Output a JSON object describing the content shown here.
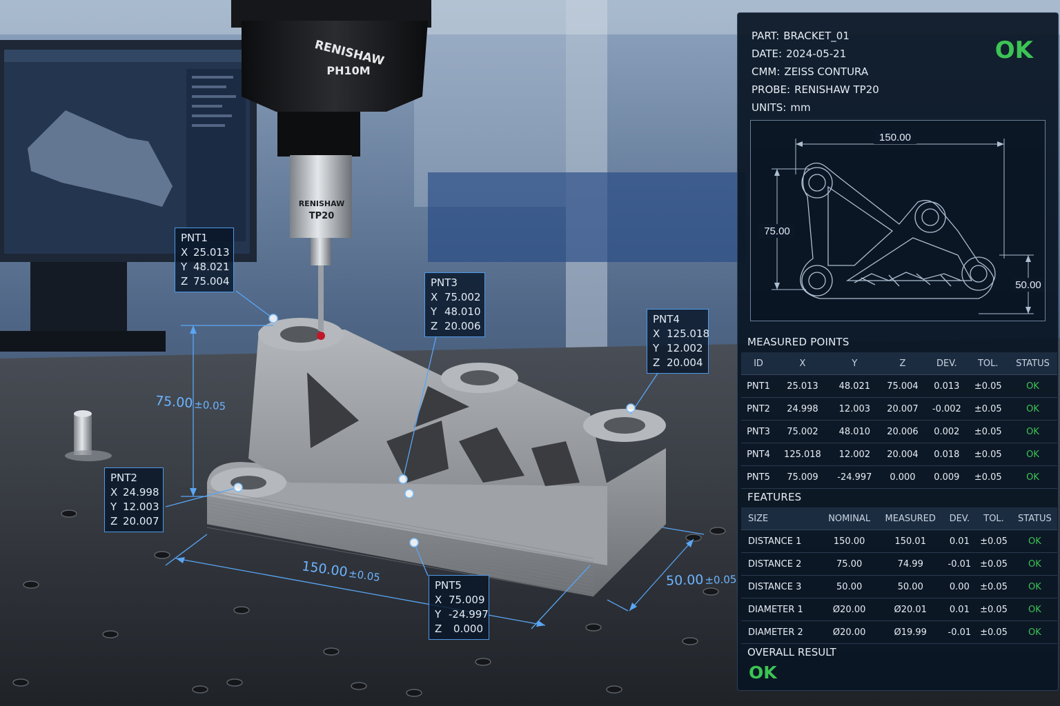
{
  "probe_head": {
    "brand": "RENISHAW",
    "model": "PH10M"
  },
  "probe_body": {
    "brand": "RENISHAW",
    "model": "TP20"
  },
  "points": [
    {
      "id": "PNT1",
      "x": "25.013",
      "y": "48.021",
      "z": "75.004"
    },
    {
      "id": "PNT2",
      "x": "24.998",
      "y": "12.003",
      "z": "20.007"
    },
    {
      "id": "PNT3",
      "x": "75.002",
      "y": "48.010",
      "z": "20.006"
    },
    {
      "id": "PNT4",
      "x": "125.018",
      "y": "12.002",
      "z": "20.004"
    },
    {
      "id": "PNT5",
      "x": "75.009",
      "y": "-24.997",
      "z": "0.000"
    }
  ],
  "axis_labels": {
    "x": "X",
    "y": "Y",
    "z": "Z"
  },
  "dims": {
    "height": {
      "value": "75.00",
      "tol": "±0.05"
    },
    "length": {
      "value": "150.00",
      "tol": "±0.05"
    },
    "width": {
      "value": "50.00",
      "tol": "±0.05"
    }
  },
  "report": {
    "meta": [
      {
        "label": "PART:",
        "value": "BRACKET_01"
      },
      {
        "label": "DATE:",
        "value": "2024-05-21"
      },
      {
        "label": "CMM:",
        "value": "ZEISS CONTURA"
      },
      {
        "label": "PROBE:",
        "value": "RENISHAW TP20"
      },
      {
        "label": "UNITS:",
        "value": "mm"
      }
    ],
    "status": "OK",
    "drawing": {
      "dim_top": "150.00",
      "dim_left": "75.00",
      "dim_right": "50.00"
    },
    "measured_points": {
      "title": "MEASURED POINTS",
      "headers": [
        "ID",
        "X",
        "Y",
        "Z",
        "DEV.",
        "TOL.",
        "STATUS"
      ],
      "rows": [
        [
          "PNT1",
          "25.013",
          "48.021",
          "75.004",
          "0.013",
          "±0.05",
          "OK"
        ],
        [
          "PNT2",
          "24.998",
          "12.003",
          "20.007",
          "-0.002",
          "±0.05",
          "OK"
        ],
        [
          "PNT3",
          "75.002",
          "48.010",
          "20.006",
          "0.002",
          "±0.05",
          "OK"
        ],
        [
          "PNT4",
          "125.018",
          "12.002",
          "20.004",
          "0.018",
          "±0.05",
          "OK"
        ],
        [
          "PNT5",
          "75.009",
          "-24.997",
          "0.000",
          "0.009",
          "±0.05",
          "OK"
        ]
      ]
    },
    "features": {
      "title": "FEATURES",
      "headers": [
        "SIZE",
        "NOMINAL",
        "MEASURED",
        "DEV.",
        "TOL.",
        "STATUS"
      ],
      "rows": [
        [
          "DISTANCE 1",
          "150.00",
          "150.01",
          "0.01",
          "±0.05",
          "OK"
        ],
        [
          "DISTANCE 2",
          "75.00",
          "74.99",
          "-0.01",
          "±0.05",
          "OK"
        ],
        [
          "DISTANCE 3",
          "50.00",
          "50.00",
          "0.00",
          "±0.05",
          "OK"
        ],
        [
          "DIAMETER 1",
          "Ø20.00",
          "Ø20.01",
          "0.01",
          "±0.05",
          "OK"
        ],
        [
          "DIAMETER 2",
          "Ø20.00",
          "Ø19.99",
          "-0.01",
          "±0.05",
          "OK"
        ]
      ]
    },
    "overall": {
      "label": "OVERALL RESULT",
      "value": "OK"
    }
  },
  "colors": {
    "accent": "#4f9ae8",
    "ok": "#3cc454",
    "panel": "#0a1624"
  }
}
